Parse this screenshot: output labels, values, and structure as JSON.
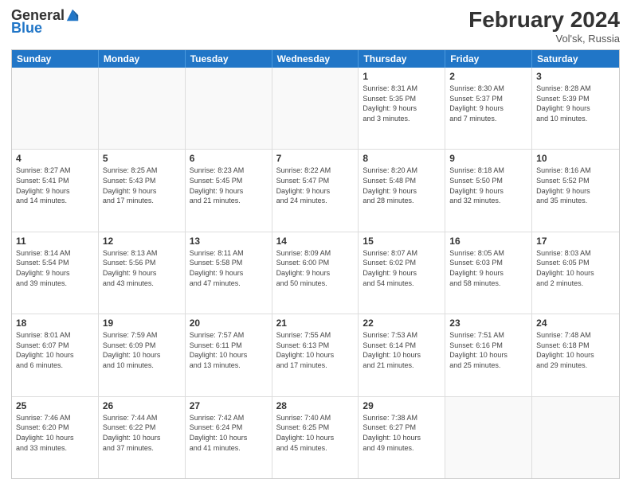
{
  "header": {
    "logo_general": "General",
    "logo_blue": "Blue",
    "month_title": "February 2024",
    "location": "Vol'sk, Russia"
  },
  "days_of_week": [
    "Sunday",
    "Monday",
    "Tuesday",
    "Wednesday",
    "Thursday",
    "Friday",
    "Saturday"
  ],
  "weeks": [
    [
      {
        "day": "",
        "info": ""
      },
      {
        "day": "",
        "info": ""
      },
      {
        "day": "",
        "info": ""
      },
      {
        "day": "",
        "info": ""
      },
      {
        "day": "1",
        "info": "Sunrise: 8:31 AM\nSunset: 5:35 PM\nDaylight: 9 hours\nand 3 minutes."
      },
      {
        "day": "2",
        "info": "Sunrise: 8:30 AM\nSunset: 5:37 PM\nDaylight: 9 hours\nand 7 minutes."
      },
      {
        "day": "3",
        "info": "Sunrise: 8:28 AM\nSunset: 5:39 PM\nDaylight: 9 hours\nand 10 minutes."
      }
    ],
    [
      {
        "day": "4",
        "info": "Sunrise: 8:27 AM\nSunset: 5:41 PM\nDaylight: 9 hours\nand 14 minutes."
      },
      {
        "day": "5",
        "info": "Sunrise: 8:25 AM\nSunset: 5:43 PM\nDaylight: 9 hours\nand 17 minutes."
      },
      {
        "day": "6",
        "info": "Sunrise: 8:23 AM\nSunset: 5:45 PM\nDaylight: 9 hours\nand 21 minutes."
      },
      {
        "day": "7",
        "info": "Sunrise: 8:22 AM\nSunset: 5:47 PM\nDaylight: 9 hours\nand 24 minutes."
      },
      {
        "day": "8",
        "info": "Sunrise: 8:20 AM\nSunset: 5:48 PM\nDaylight: 9 hours\nand 28 minutes."
      },
      {
        "day": "9",
        "info": "Sunrise: 8:18 AM\nSunset: 5:50 PM\nDaylight: 9 hours\nand 32 minutes."
      },
      {
        "day": "10",
        "info": "Sunrise: 8:16 AM\nSunset: 5:52 PM\nDaylight: 9 hours\nand 35 minutes."
      }
    ],
    [
      {
        "day": "11",
        "info": "Sunrise: 8:14 AM\nSunset: 5:54 PM\nDaylight: 9 hours\nand 39 minutes."
      },
      {
        "day": "12",
        "info": "Sunrise: 8:13 AM\nSunset: 5:56 PM\nDaylight: 9 hours\nand 43 minutes."
      },
      {
        "day": "13",
        "info": "Sunrise: 8:11 AM\nSunset: 5:58 PM\nDaylight: 9 hours\nand 47 minutes."
      },
      {
        "day": "14",
        "info": "Sunrise: 8:09 AM\nSunset: 6:00 PM\nDaylight: 9 hours\nand 50 minutes."
      },
      {
        "day": "15",
        "info": "Sunrise: 8:07 AM\nSunset: 6:02 PM\nDaylight: 9 hours\nand 54 minutes."
      },
      {
        "day": "16",
        "info": "Sunrise: 8:05 AM\nSunset: 6:03 PM\nDaylight: 9 hours\nand 58 minutes."
      },
      {
        "day": "17",
        "info": "Sunrise: 8:03 AM\nSunset: 6:05 PM\nDaylight: 10 hours\nand 2 minutes."
      }
    ],
    [
      {
        "day": "18",
        "info": "Sunrise: 8:01 AM\nSunset: 6:07 PM\nDaylight: 10 hours\nand 6 minutes."
      },
      {
        "day": "19",
        "info": "Sunrise: 7:59 AM\nSunset: 6:09 PM\nDaylight: 10 hours\nand 10 minutes."
      },
      {
        "day": "20",
        "info": "Sunrise: 7:57 AM\nSunset: 6:11 PM\nDaylight: 10 hours\nand 13 minutes."
      },
      {
        "day": "21",
        "info": "Sunrise: 7:55 AM\nSunset: 6:13 PM\nDaylight: 10 hours\nand 17 minutes."
      },
      {
        "day": "22",
        "info": "Sunrise: 7:53 AM\nSunset: 6:14 PM\nDaylight: 10 hours\nand 21 minutes."
      },
      {
        "day": "23",
        "info": "Sunrise: 7:51 AM\nSunset: 6:16 PM\nDaylight: 10 hours\nand 25 minutes."
      },
      {
        "day": "24",
        "info": "Sunrise: 7:48 AM\nSunset: 6:18 PM\nDaylight: 10 hours\nand 29 minutes."
      }
    ],
    [
      {
        "day": "25",
        "info": "Sunrise: 7:46 AM\nSunset: 6:20 PM\nDaylight: 10 hours\nand 33 minutes."
      },
      {
        "day": "26",
        "info": "Sunrise: 7:44 AM\nSunset: 6:22 PM\nDaylight: 10 hours\nand 37 minutes."
      },
      {
        "day": "27",
        "info": "Sunrise: 7:42 AM\nSunset: 6:24 PM\nDaylight: 10 hours\nand 41 minutes."
      },
      {
        "day": "28",
        "info": "Sunrise: 7:40 AM\nSunset: 6:25 PM\nDaylight: 10 hours\nand 45 minutes."
      },
      {
        "day": "29",
        "info": "Sunrise: 7:38 AM\nSunset: 6:27 PM\nDaylight: 10 hours\nand 49 minutes."
      },
      {
        "day": "",
        "info": ""
      },
      {
        "day": "",
        "info": ""
      }
    ]
  ]
}
